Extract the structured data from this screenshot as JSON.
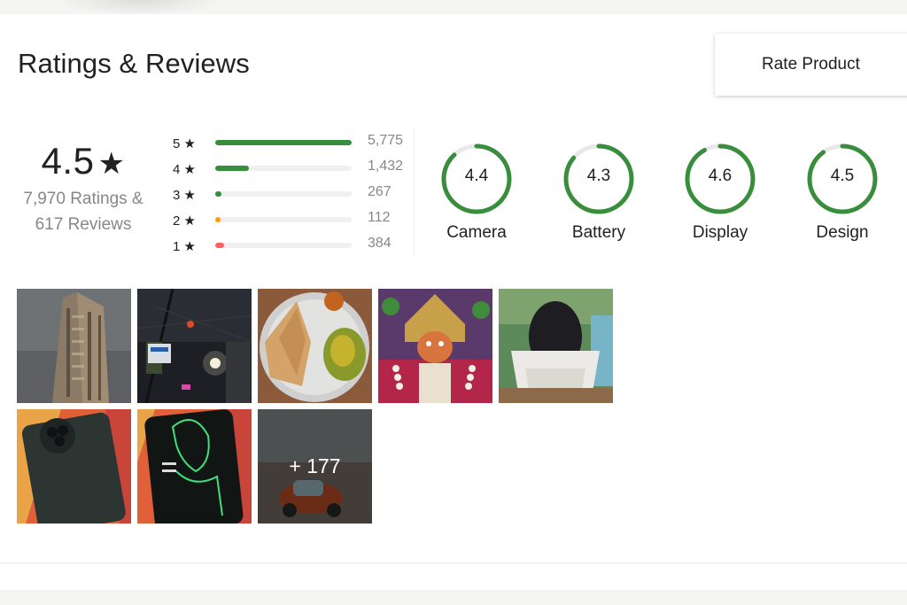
{
  "header": {
    "title": "Ratings & Reviews",
    "rate_button": "Rate Product"
  },
  "overall": {
    "average": "4.5",
    "star": "★",
    "ratings_line": "7,970 Ratings &",
    "reviews_line": "617 Reviews"
  },
  "distribution": [
    {
      "label": "5 ★",
      "count": "5,775",
      "fraction": 1.0,
      "color": "#388e3c"
    },
    {
      "label": "4 ★",
      "count": "1,432",
      "fraction": 0.248,
      "color": "#388e3c"
    },
    {
      "label": "3 ★",
      "count": "267",
      "fraction": 0.046,
      "color": "#388e3c"
    },
    {
      "label": "2 ★",
      "count": "112",
      "fraction": 0.019,
      "color": "#ff9f00"
    },
    {
      "label": "1 ★",
      "count": "384",
      "fraction": 0.066,
      "color": "#ff6161"
    }
  ],
  "aspects": [
    {
      "label": "Camera",
      "value": "4.4",
      "score": 4.4
    },
    {
      "label": "Battery",
      "value": "4.3",
      "score": 4.3
    },
    {
      "label": "Display",
      "value": "4.6",
      "score": 4.6
    },
    {
      "label": "Design",
      "value": "4.5",
      "score": 4.5
    }
  ],
  "photos": {
    "thumbnails": [
      "building-photo",
      "street-night-photo",
      "food-plate-photo",
      "deity-idol-photo",
      "ganesha-idol-photo",
      "phone-back-photo",
      "phone-screen-photo"
    ],
    "more_label": "+ 177"
  },
  "colors": {
    "accent": "#388e3c",
    "ring_track": "#e8e8e8",
    "muted": "#878787"
  }
}
